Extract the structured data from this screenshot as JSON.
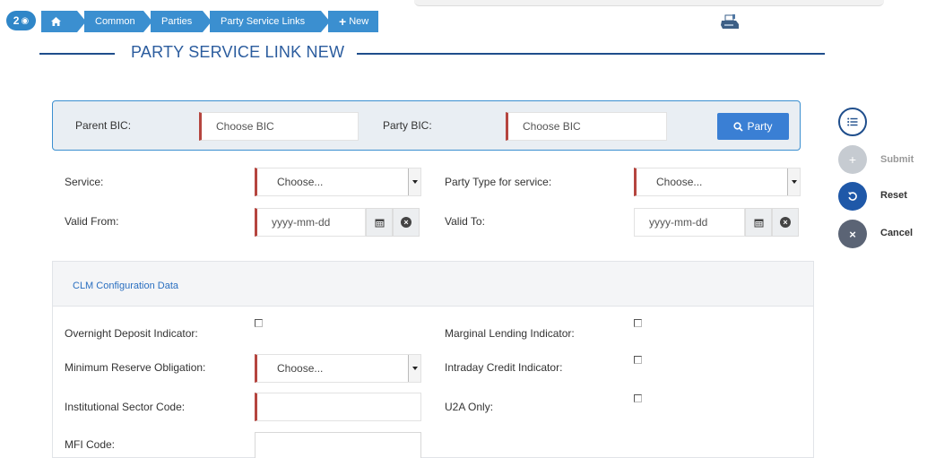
{
  "breadcrumb": {
    "badge_count": "2",
    "items": [
      "Common",
      "Parties",
      "Party Service Links",
      "New"
    ]
  },
  "page_title": "PARTY SERVICE LINK NEW",
  "bic_panel": {
    "parent_bic_label": "Parent BIC:",
    "parent_bic_placeholder": "Choose BIC",
    "party_bic_label": "Party BIC:",
    "party_bic_placeholder": "Choose BIC",
    "party_button": "Party"
  },
  "form": {
    "service_label": "Service:",
    "service_value": "Choose...",
    "party_type_label": "Party Type for service:",
    "party_type_value": "Choose...",
    "valid_from_label": "Valid From:",
    "valid_from_placeholder": "yyyy-mm-dd",
    "valid_to_label": "Valid To:",
    "valid_to_placeholder": "yyyy-mm-dd"
  },
  "actions": {
    "submit": "Submit",
    "reset": "Reset",
    "cancel": "Cancel"
  },
  "clm": {
    "title": "CLM Configuration Data",
    "overnight_label": "Overnight Deposit Indicator:",
    "marginal_label": "Marginal Lending Indicator:",
    "min_reserve_label": "Minimum Reserve Obligation:",
    "min_reserve_value": "Choose...",
    "intraday_label": "Intraday Credit Indicator:",
    "sector_label": "Institutional Sector Code:",
    "u2a_label": "U2A Only:",
    "mfi_label": "MFI Code:"
  },
  "colors": {
    "accent": "#3b8fd0",
    "title": "#2b5c9e",
    "required": "#b5453f"
  }
}
